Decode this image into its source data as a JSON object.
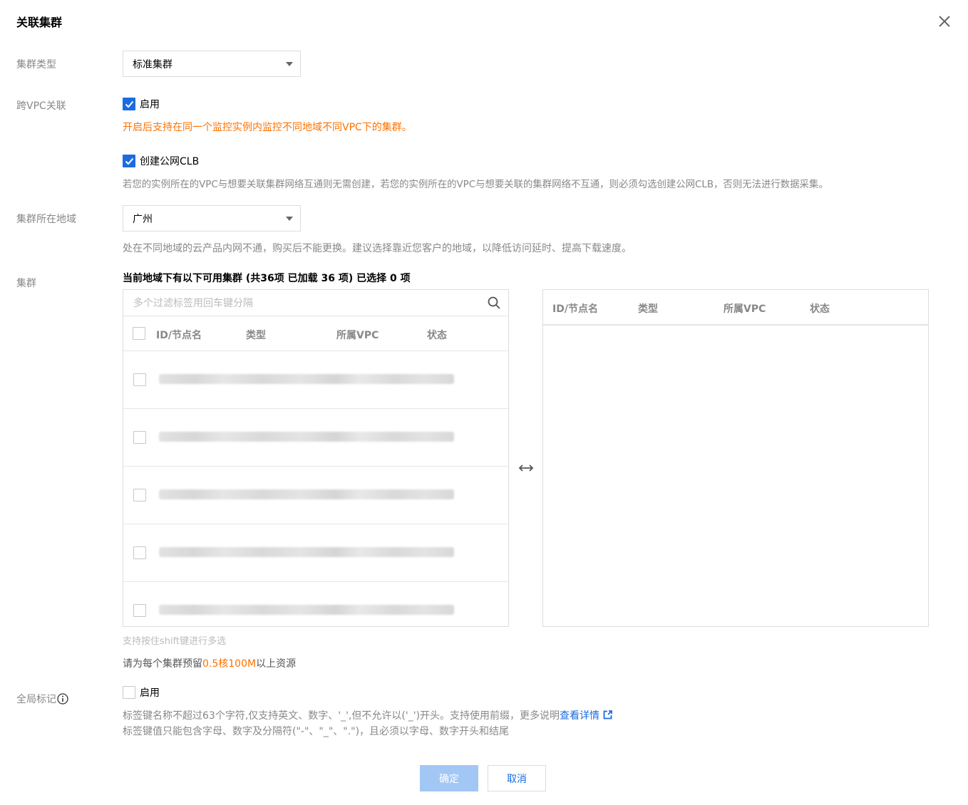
{
  "dialog": {
    "title": "关联集群"
  },
  "cluster_type": {
    "label": "集群类型",
    "value": "标准集群"
  },
  "cross_vpc": {
    "label": "跨VPC关联",
    "enable_label": "启用",
    "enabled": true,
    "help": "开启后支持在同一个监控实例内监控不同地域不同VPC下的集群。"
  },
  "public_clb": {
    "label": "创建公网CLB",
    "checked": true,
    "help": "若您的实例所在的VPC与想要关联集群网络互通则无需创建，若您的实例所在的VPC与想要关联的集群网络不互通，则必须勾选创建公网CLB，否则无法进行数据采集。"
  },
  "region": {
    "label": "集群所在地域",
    "value": "广州",
    "help": "处在不同地域的云产品内网不通，购买后不能更换。建议选择靠近您客户的地域，以降低访问延时、提高下载速度。"
  },
  "cluster": {
    "label": "集群",
    "header": "当前地域下有以下可用集群 (共36项 已加载 36 项) 已选择 0 项",
    "search_placeholder": "多个过滤标签用回车键分隔",
    "columns": [
      "ID/节点名",
      "类型",
      "所属VPC",
      "状态"
    ],
    "rows_visible": 5,
    "shift_hint": "支持按住shift键进行多选",
    "reserve_prefix": "请为每个集群预留",
    "reserve_value": "0.5核100M",
    "reserve_suffix": "以上资源"
  },
  "global_tag": {
    "label": "全局标记",
    "enable_label": "启用",
    "enabled": false,
    "help_line1": "标签键名称不超过63个字符,仅支持英文、数字、'_',但不允许以('_')开头。支持使用前缀，更多说明",
    "help_link": "查看详情",
    "help_line2": "标签键值只能包含字母、数字及分隔符(\"-\"、\"_\"、\".\")，且必须以字母、数字开头和结尾"
  },
  "footer": {
    "ok_label": "确定",
    "cancel_label": "取消"
  },
  "colors": {
    "accent": "#1b6ce0",
    "warning": "#ff7200",
    "disabled_button": "#a3c7f5"
  }
}
